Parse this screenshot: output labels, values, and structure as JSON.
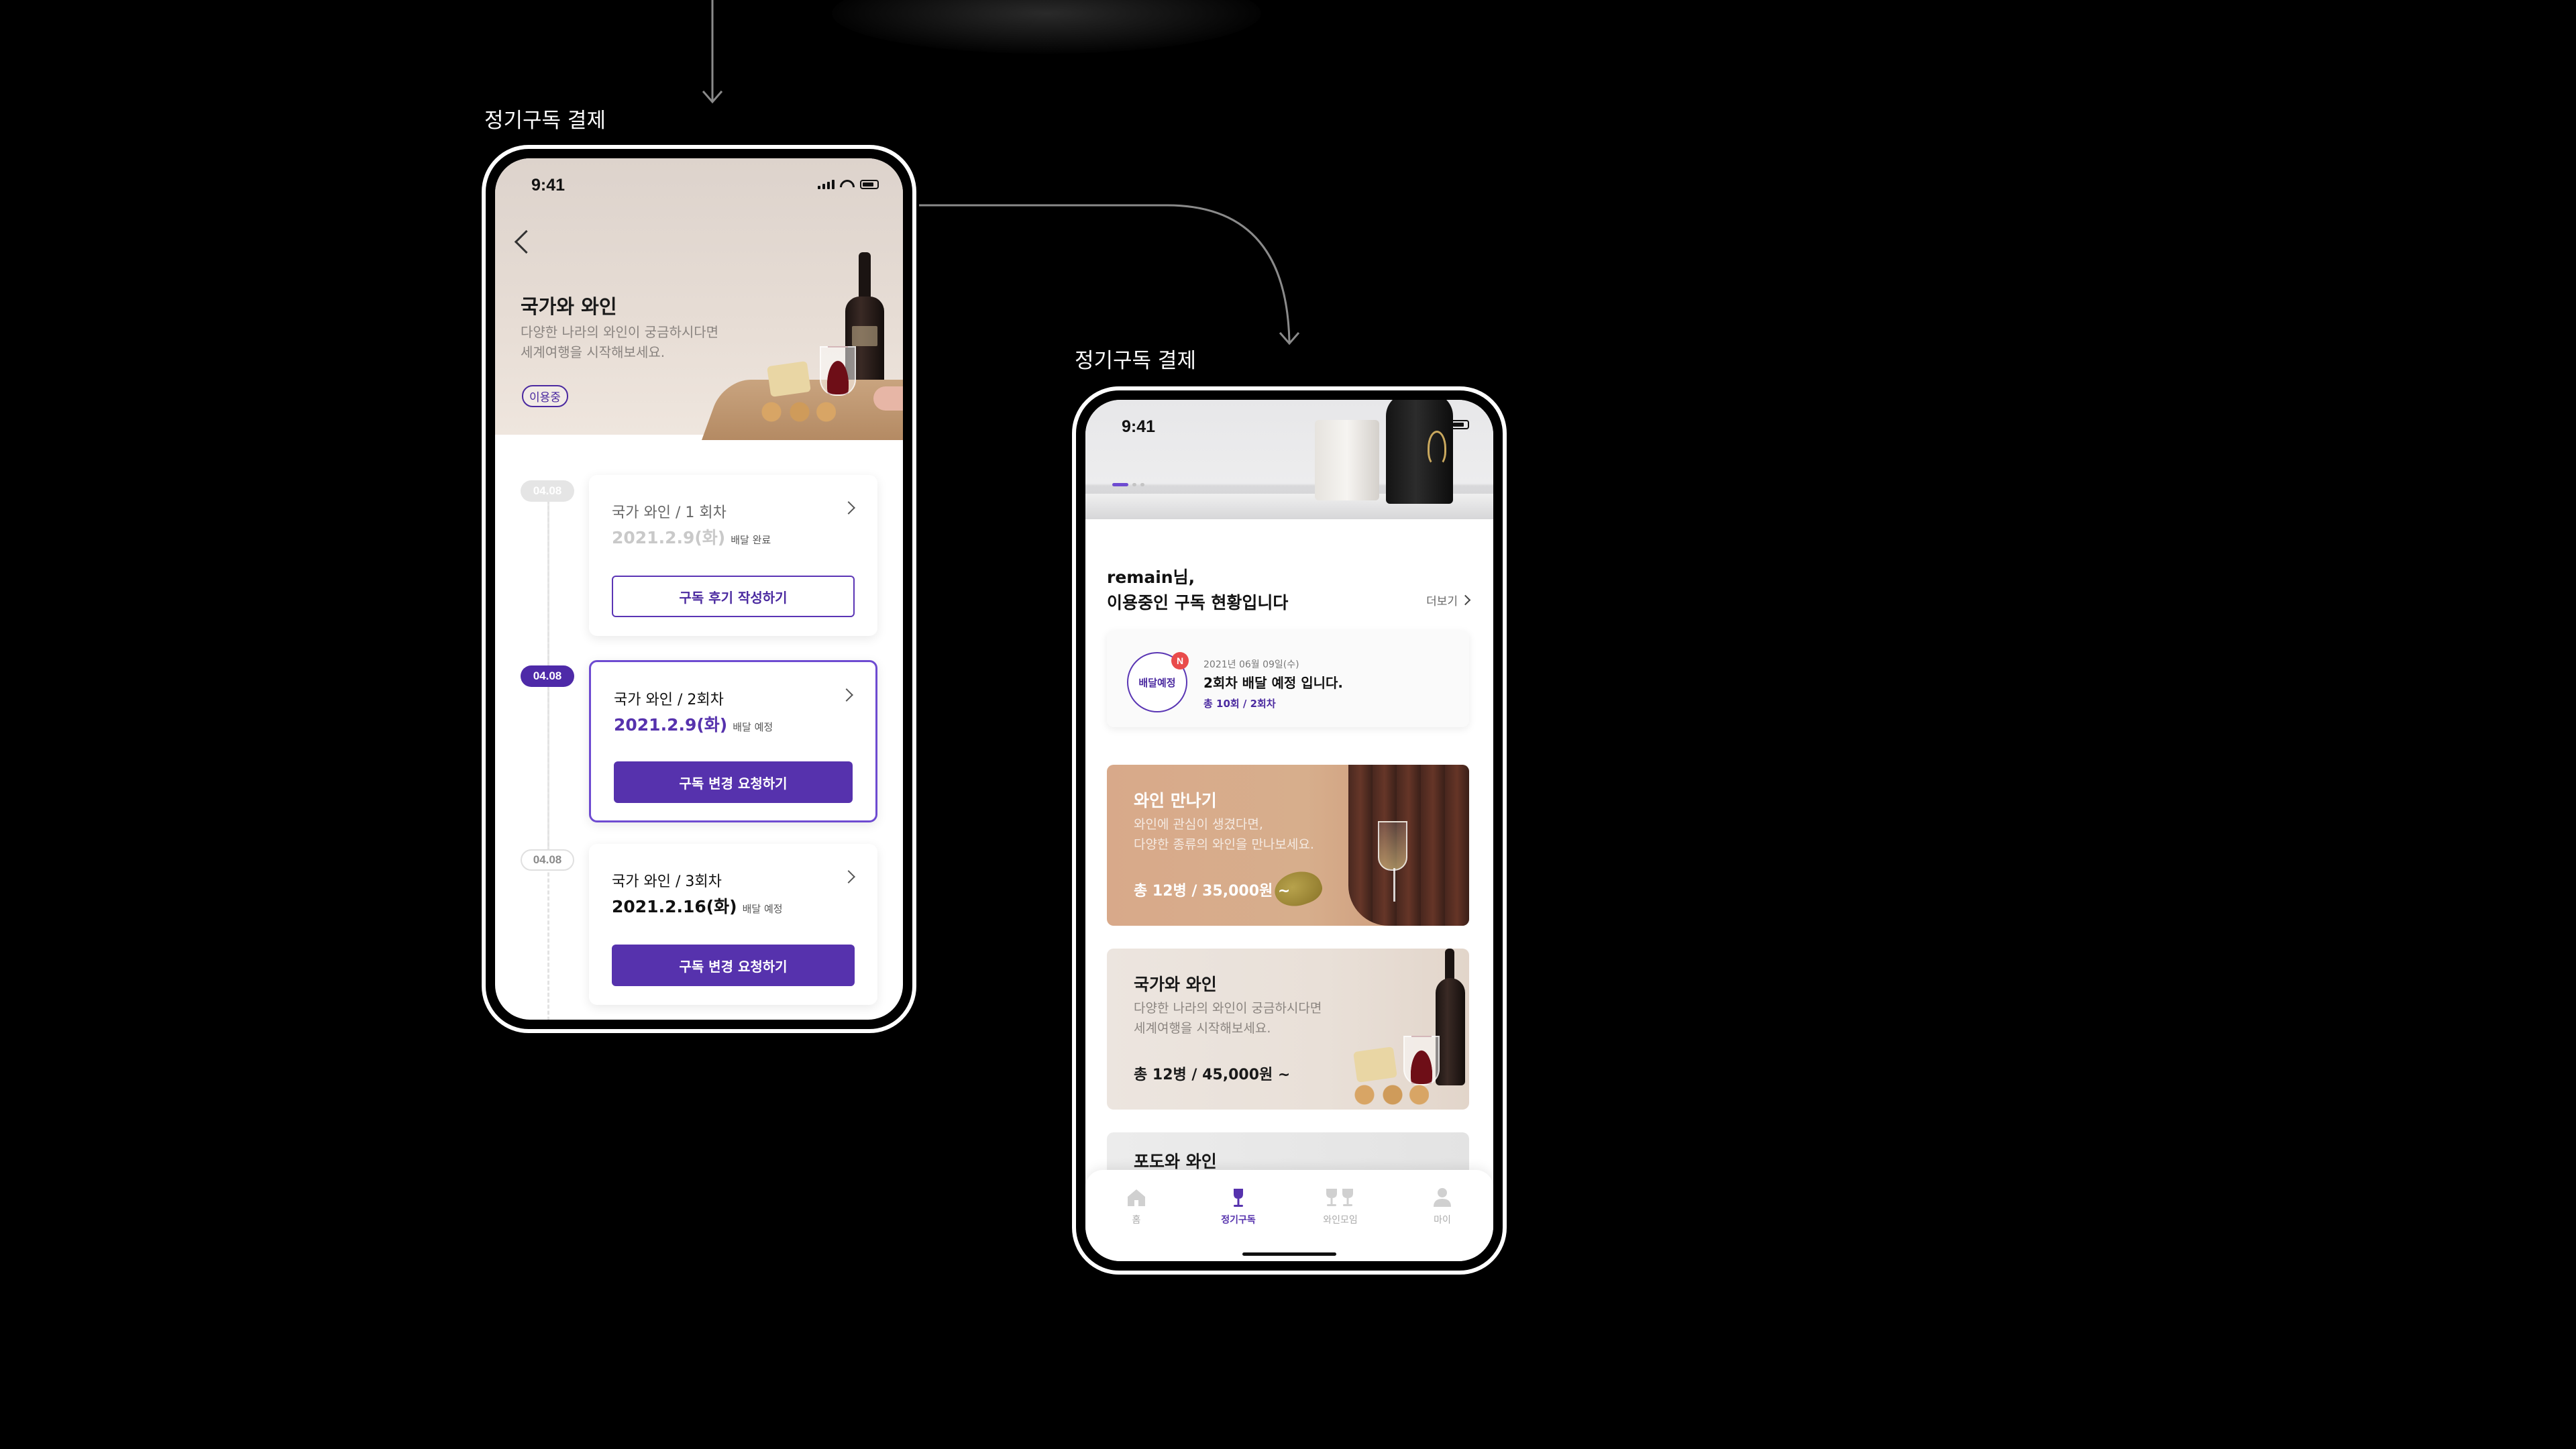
{
  "captions": {
    "left": "정기구독 결제",
    "right": "정기구독 결제"
  },
  "phone1": {
    "status": {
      "time": "9:41"
    },
    "hero": {
      "title": "국가와 와인",
      "desc_line1": "다양한 나라의 와인이 궁금하시다면",
      "desc_line2": "세계여행을 시작해보세요.",
      "chip": "이용중"
    },
    "timeline": [
      {
        "date": "04.08",
        "state": "done",
        "title": "국가 와인 / 1 회차",
        "delivery_date": "2021.2.9(화)",
        "delivery_status": "배달 완료",
        "button": "구독 후기 작성하기",
        "button_style": "outline"
      },
      {
        "date": "04.08",
        "state": "active",
        "title": "국가 와인 / 2회차",
        "delivery_date": "2021.2.9(화)",
        "delivery_status": "배달 예정",
        "button": "구독 변경 요청하기",
        "button_style": "fill"
      },
      {
        "date": "04.08",
        "state": "future",
        "title": "국가 와인 / 3회차",
        "delivery_date": "2021.2.16(화)",
        "delivery_status": "배달 예정",
        "button": "구독 변경 요청하기",
        "button_style": "fill"
      }
    ]
  },
  "phone2": {
    "status": {
      "time": "9:41"
    },
    "greeting_line1": "remain님,",
    "greeting_line2": "이용중인 구독 현황입니다",
    "more_label": "더보기",
    "status_card": {
      "circle_label": "배달예정",
      "badge": "N",
      "date": "2021년 06월 09일(수)",
      "main": "2회차 배달 예정 입니다.",
      "sub": "총 10회 / 2회차"
    },
    "products": [
      {
        "title": "와인 만나기",
        "desc_line1": "와인에 관심이 생겼다면,",
        "desc_line2": "다양한 종류의 와인을 만나보세요.",
        "price": "총 12병 / 35,000원 ~"
      },
      {
        "title": "국가와 와인",
        "desc_line1": "다양한 나라의 와인이 궁금하시다면",
        "desc_line2": "세계여행을 시작해보세요.",
        "price": "총 12병 / 45,000원 ~"
      },
      {
        "title": "포도와 와인"
      }
    ],
    "tabs": [
      {
        "label": "홈",
        "icon": "home-icon",
        "active": false
      },
      {
        "label": "정기구독",
        "icon": "wine-glass-icon",
        "active": true
      },
      {
        "label": "와인모임",
        "icon": "wine-glasses-icon",
        "active": false
      },
      {
        "label": "마이",
        "icon": "person-icon",
        "active": false
      }
    ]
  },
  "colors": {
    "accent": "#5632ad",
    "badge_red": "#e94b4b",
    "background": "#000000"
  }
}
